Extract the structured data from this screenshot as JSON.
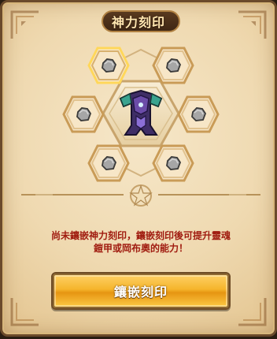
{
  "dialog": {
    "title": "神力刻印",
    "description_lines": [
      "尚未鑲嵌神力刻印，鑲嵌刻印後可提升靈魂",
      "鎧甲或岡布奧的能力！"
    ],
    "button_label": "鑲嵌刻印"
  },
  "slots": [
    {
      "id": "top-left",
      "state": "selected",
      "icon": "rune-stone-icon"
    },
    {
      "id": "top-right",
      "state": "normal",
      "icon": "rune-stone-icon"
    },
    {
      "id": "mid-left",
      "state": "normal",
      "icon": "rune-stone-icon"
    },
    {
      "id": "mid-right",
      "state": "normal",
      "icon": "rune-stone-icon"
    },
    {
      "id": "bottom-left",
      "state": "normal",
      "icon": "rune-stone-icon"
    },
    {
      "id": "bottom-right",
      "state": "normal",
      "icon": "rune-stone-icon"
    }
  ],
  "colors": {
    "accent_red": "#a01c10",
    "button_gold": "#f5b52c",
    "panel_parchment": "#efd9b0",
    "frame_brown": "#6b4a2b",
    "selected_glow": "#ffd75a"
  }
}
